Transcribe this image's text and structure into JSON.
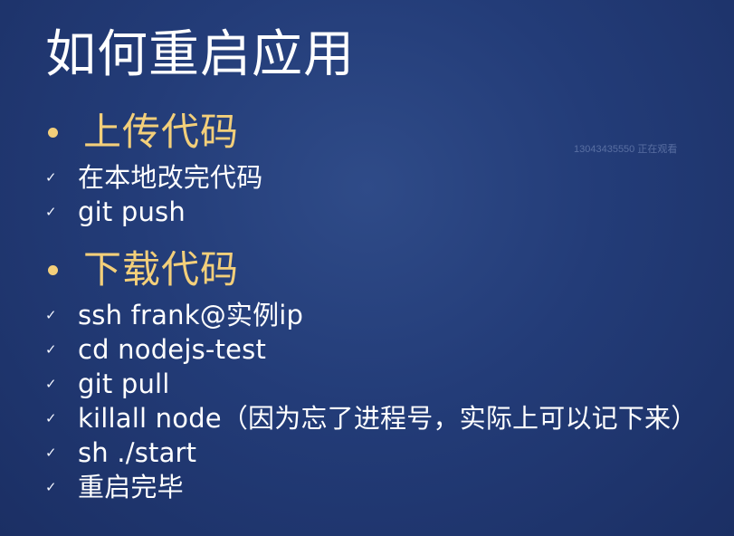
{
  "slide": {
    "title": "如何重启应用",
    "watermark": "13043435550 正在观看",
    "sections": [
      {
        "heading": "上传代码",
        "items": [
          "在本地改完代码",
          "git push"
        ]
      },
      {
        "heading": "下载代码",
        "items": [
          "ssh frank@实例ip",
          "cd nodejs-test",
          "git pull",
          "killall node（因为忘了进程号，实际上可以记下来）",
          "sh ./start",
          "重启完毕"
        ]
      }
    ]
  },
  "icons": {
    "bullet": "dot-bullet-icon",
    "check": "checkmark-icon"
  },
  "colors": {
    "background": "#233c78",
    "heading": "#f3cf7a",
    "text": "#ffffff"
  }
}
